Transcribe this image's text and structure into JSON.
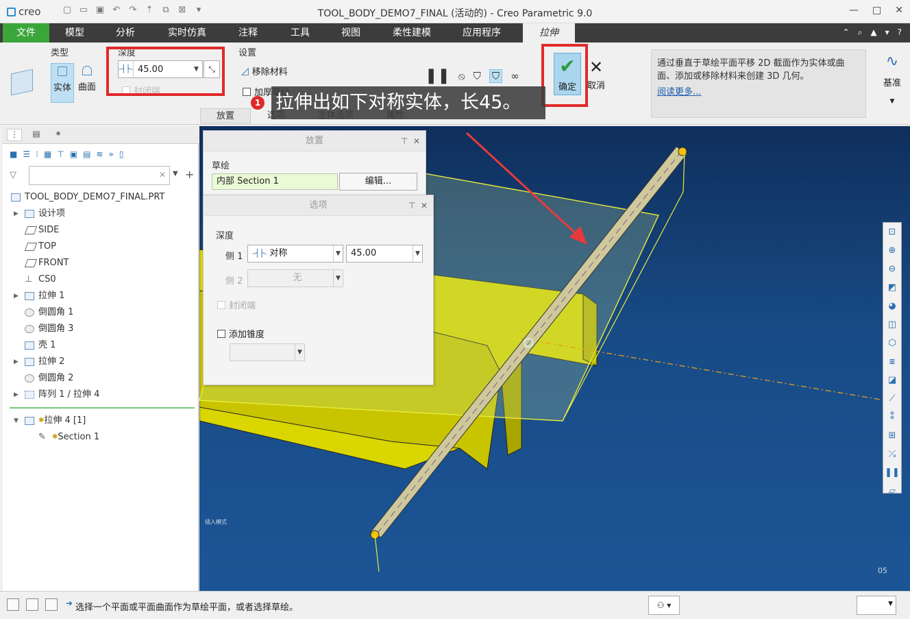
{
  "window": {
    "logo": "creo",
    "title": "TOOL_BODY_DEMO7_FINAL (活动的) - Creo Parametric 9.0",
    "controls": [
      "—",
      "□",
      "✕"
    ]
  },
  "menu": {
    "tabs": [
      "文件",
      "模型",
      "分析",
      "实时仿真",
      "注释",
      "工具",
      "视图",
      "柔性建模",
      "应用程序",
      "拉伸"
    ]
  },
  "ribbon": {
    "type_label": "类型",
    "solid_label": "实体",
    "surface_label": "曲面",
    "depth_label": "深度",
    "depth_value": "45.00",
    "cap_label": "封闭端",
    "settings_label": "设置",
    "remove_material": "移除材料",
    "thicken_sketch": "加厚草绘",
    "ok_label": "确定",
    "cancel_label": "取消",
    "help_text": "通过垂直于草绘平面平移 2D 截面作为实体或曲面、添加或移除材料来创建 3D 几何。",
    "help_link": "阅读更多...",
    "datum_label": "基准",
    "subtabs": [
      "放置",
      "选项",
      "主体选项",
      "属性"
    ]
  },
  "annotation": {
    "badge": "1",
    "text": "拉伸出如下对称实体，长45。"
  },
  "model_tree": {
    "filter_placeholder": "",
    "items": [
      {
        "label": "TOOL_BODY_DEMO7_FINAL.PRT",
        "indent": 0,
        "expander": ""
      },
      {
        "label": "设计项",
        "indent": 1,
        "expander": "▶"
      },
      {
        "label": "SIDE",
        "indent": 1,
        "expander": ""
      },
      {
        "label": "TOP",
        "indent": 1,
        "expander": ""
      },
      {
        "label": "FRONT",
        "indent": 1,
        "expander": ""
      },
      {
        "label": "CS0",
        "indent": 1,
        "expander": ""
      },
      {
        "label": "拉伸 1",
        "indent": 1,
        "expander": "▶"
      },
      {
        "label": "倒圆角 1",
        "indent": 1,
        "expander": ""
      },
      {
        "label": "倒圆角 3",
        "indent": 1,
        "expander": ""
      },
      {
        "label": "壳 1",
        "indent": 1,
        "expander": ""
      },
      {
        "label": "拉伸 2",
        "indent": 1,
        "expander": "▶"
      },
      {
        "label": "倒圆角 2",
        "indent": 1,
        "expander": ""
      },
      {
        "label": "阵列 1 / 拉伸 4",
        "indent": 1,
        "expander": "▶"
      }
    ],
    "insert_items": [
      {
        "label": "拉伸 4 [1]",
        "expander": "▼"
      },
      {
        "label": "Section 1",
        "expander": ""
      }
    ]
  },
  "placement_dialog": {
    "title": "放置",
    "sketch_label": "草绘",
    "sketch_value": "内部 Section 1",
    "edit_button": "编辑..."
  },
  "options_dialog": {
    "title": "选项",
    "depth_label": "深度",
    "side1_label": "侧 1",
    "side1_type": "对称",
    "side1_value": "45.00",
    "side2_label": "侧 2",
    "side2_type": "无",
    "capped_label": "封闭端",
    "taper_label": "添加锥度"
  },
  "viewport": {
    "insert_mode": "插入模式",
    "axis_label": "05"
  },
  "status": {
    "message": "选择一个平面或平面曲面作为草绘平面，或者选择草绘。"
  },
  "colors": {
    "accent_green": "#3aa63a",
    "highlight_red": "#e02a2a",
    "model_yellow": "#d9d600",
    "rod_tan": "#cfc89a"
  }
}
